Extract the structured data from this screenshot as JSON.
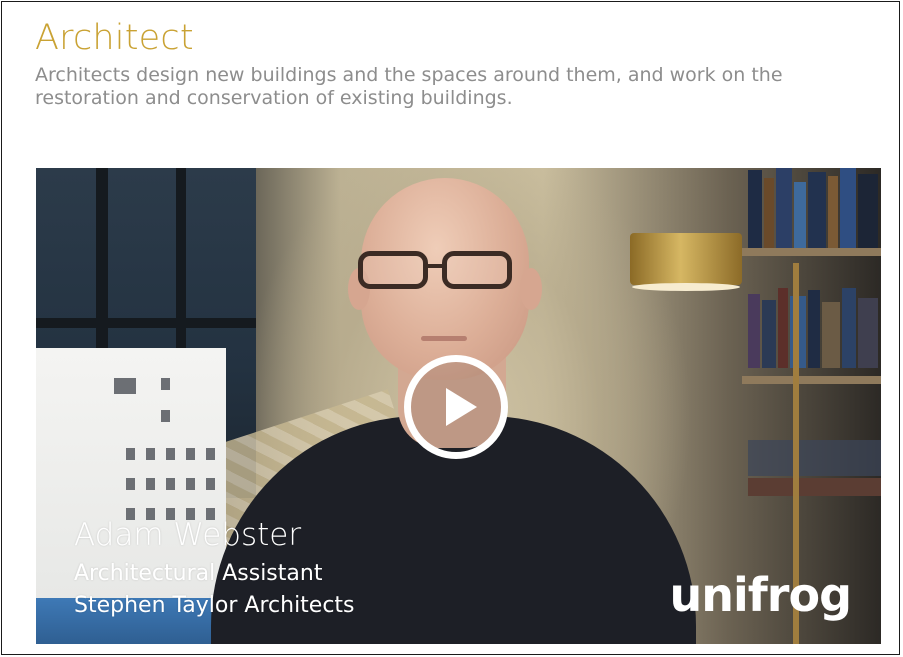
{
  "career": {
    "title": "Architect",
    "description": "Architects design new buildings and the spaces around them, and work on the restoration and conservation of existing buildings."
  },
  "video": {
    "caption_name": "Adam Webster",
    "caption_role": "Architectural Assistant",
    "caption_company": "Stephen Taylor Architects",
    "brand": "unifrog",
    "play_icon": "play-icon"
  },
  "colors": {
    "title": "#c9a233",
    "description": "#8d8d8d"
  }
}
